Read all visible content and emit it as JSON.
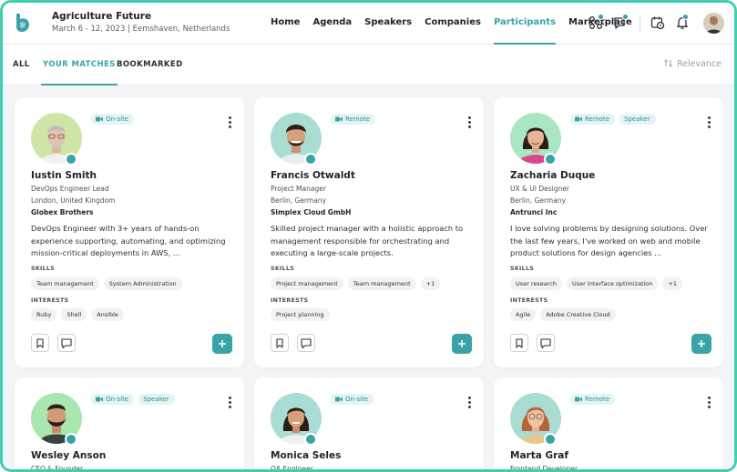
{
  "brand": {
    "accent": "#3aa3a8",
    "frame": "#3fcfae"
  },
  "event": {
    "title": "Agriculture Future",
    "subtitle": "March 6 - 12, 2023  |  Eemshaven, Netherlands"
  },
  "nav": {
    "items": [
      {
        "label": "Home"
      },
      {
        "label": "Agenda"
      },
      {
        "label": "Speakers"
      },
      {
        "label": "Companies"
      },
      {
        "label": "Participants",
        "active": true
      },
      {
        "label": "Marketplace"
      }
    ]
  },
  "header_icons": [
    "grid-apps-icon",
    "chat-icon",
    "calendar-clock-icon",
    "bell-icon",
    "user-avatar"
  ],
  "tabs": {
    "all": "ALL",
    "matches": "YOUR MATCHES",
    "bookmarked": "BOOKMARKED",
    "active": "YOUR MATCHES"
  },
  "sort": {
    "label": "Relevance",
    "icon": "sort-arrows-icon"
  },
  "labels": {
    "skills": "SKILLS",
    "interests": "INTERESTS"
  },
  "participants": [
    {
      "name": "Iustin Smith",
      "role": "DevOps Engineer Lead",
      "location": "London, United Kingdom",
      "company": "Globex Brothers",
      "badges": [
        "On-site"
      ],
      "bio": "DevOps Engineer with 3+ years of hands-on experience supporting, automating, and optimizing mission-critical deployments in AWS, ...",
      "skills": [
        "Team management",
        "System Administration"
      ],
      "interests": [
        "Ruby",
        "Shell",
        "Ansible"
      ]
    },
    {
      "name": "Francis Otwaldt",
      "role": "Project Manager",
      "location": "Berlin, Germany",
      "company": "Simplex Cloud GmbH",
      "badges": [
        "Remote"
      ],
      "bio": "Skilled project manager with a holistic approach to management responsible for orchestrating and executing a large-scale projects.",
      "skills": [
        "Project management",
        "Team management",
        "+1"
      ],
      "interests": [
        "Project planning"
      ]
    },
    {
      "name": "Zacharia Duque",
      "role": "UX & UI Designer",
      "location": "Berlin, Germany",
      "company": "Antrunci Inc",
      "badges": [
        "Remote",
        "Speaker"
      ],
      "bio": "I love solving problems by designing solutions. Over the last few years, I've worked on web and mobile product solutions for design agencies ...",
      "skills": [
        "User research",
        "User interface optimization",
        "+1"
      ],
      "interests": [
        "Agile",
        "Adobe Creative Cloud"
      ]
    },
    {
      "name": "Wesley Anson",
      "role": "CEO & Founder",
      "badges": [
        "On-site",
        "Speaker"
      ]
    },
    {
      "name": "Monica Seles",
      "role": "QA Engineer",
      "badges": [
        "On-site"
      ]
    },
    {
      "name": "Marta Graf",
      "role": "Frontend Developer",
      "badges": [
        "Remote"
      ]
    }
  ]
}
